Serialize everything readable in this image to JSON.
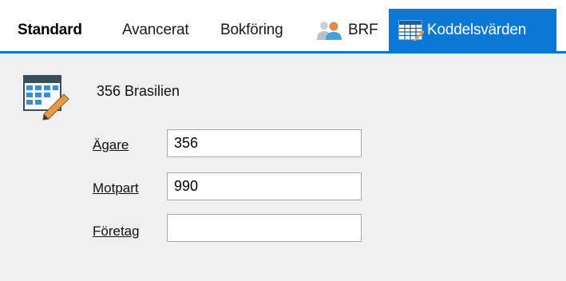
{
  "tabs": {
    "standard": "Standard",
    "avancerat": "Avancerat",
    "bokforing": "Bokföring",
    "brf": "BRF",
    "koddelsvarden": "Koddelsvärden"
  },
  "colors": {
    "accent": "#0a78d4",
    "panel_background": "#f0f0f0"
  },
  "icons": {
    "brf": "people-icon",
    "koddelsvarden": "table-icon",
    "form": "table-edit-icon"
  },
  "item": {
    "title": "356 Brasilien"
  },
  "fields": {
    "agare": {
      "label": "Ägare",
      "value": "356"
    },
    "motpart": {
      "label": "Motpart",
      "value": "990"
    },
    "foretag": {
      "label": "Företag",
      "value": ""
    }
  }
}
